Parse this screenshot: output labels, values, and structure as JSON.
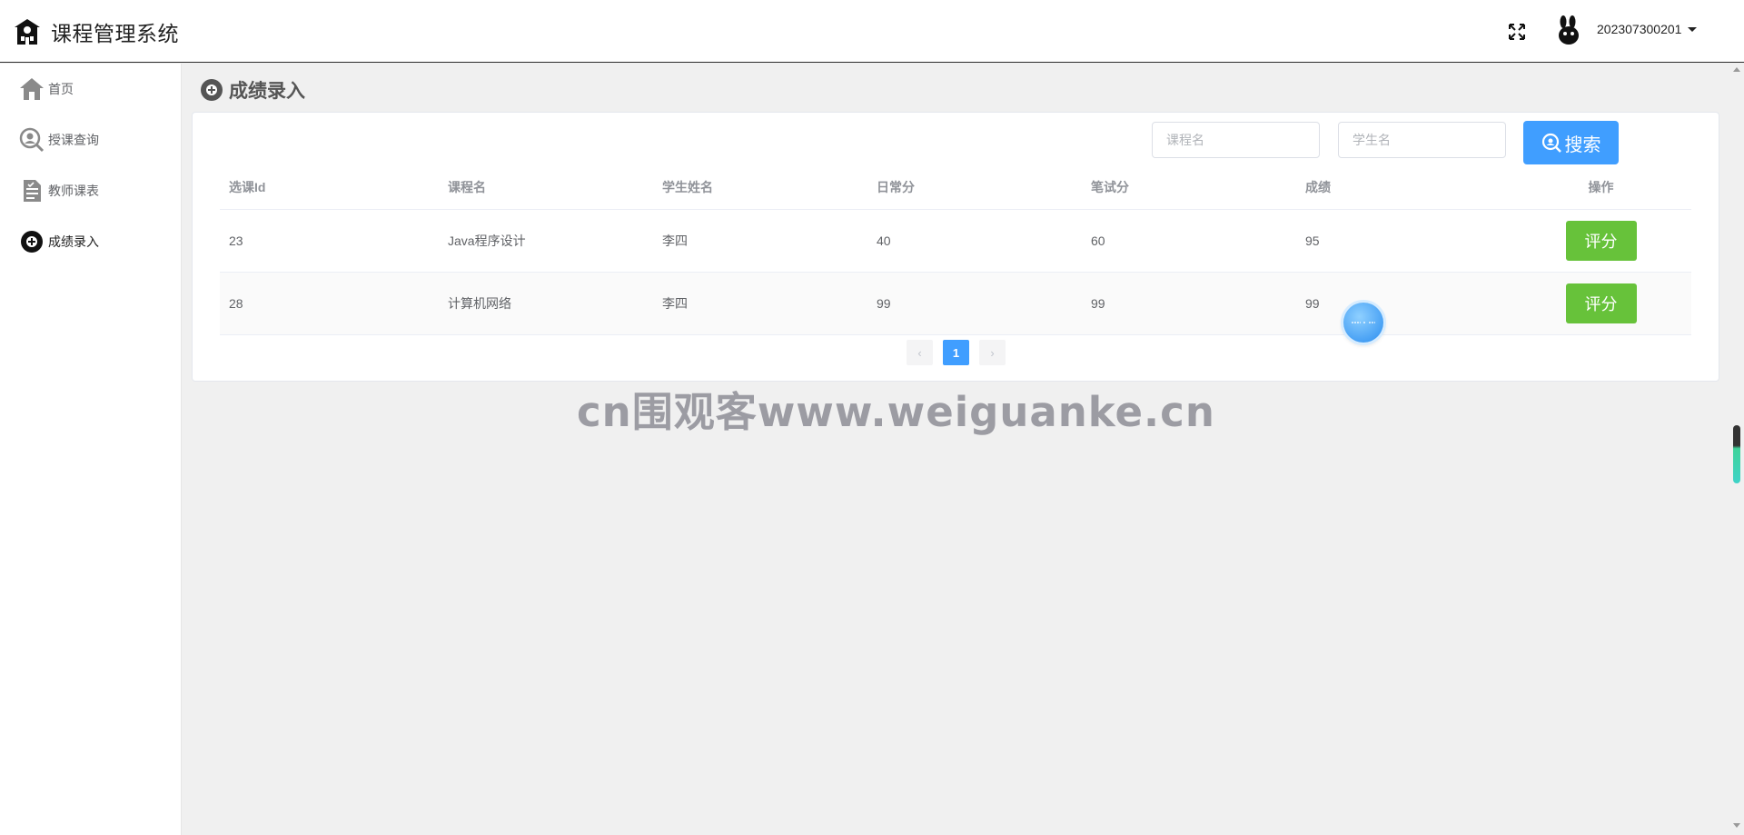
{
  "header": {
    "title": "课程管理系统",
    "username": "202307300201"
  },
  "sidebar": {
    "items": [
      {
        "label": "首页",
        "icon": "home-icon"
      },
      {
        "label": "授课查询",
        "icon": "search-person-icon"
      },
      {
        "label": "教师课表",
        "icon": "document-icon"
      },
      {
        "label": "成绩录入",
        "icon": "add-circle-icon",
        "active": true
      }
    ]
  },
  "page": {
    "title": "成绩录入"
  },
  "search": {
    "course_placeholder": "课程名",
    "student_placeholder": "学生名",
    "button_label": "搜索"
  },
  "table": {
    "columns": [
      "选课Id",
      "课程名",
      "学生姓名",
      "日常分",
      "笔试分",
      "成绩",
      "操作"
    ],
    "rows": [
      {
        "id": "23",
        "course": "Java程序设计",
        "student": "李四",
        "daily": "40",
        "written": "60",
        "score": "95",
        "action": "评分"
      },
      {
        "id": "28",
        "course": "计算机网络",
        "student": "李四",
        "daily": "99",
        "written": "99",
        "score": "99",
        "action": "评分"
      }
    ]
  },
  "pagination": {
    "prev": "‹",
    "current": "1",
    "next": "›"
  },
  "watermark": "cn围观客www.weiguanke.cn",
  "colors": {
    "primary": "#409eff",
    "success": "#67c23a"
  }
}
